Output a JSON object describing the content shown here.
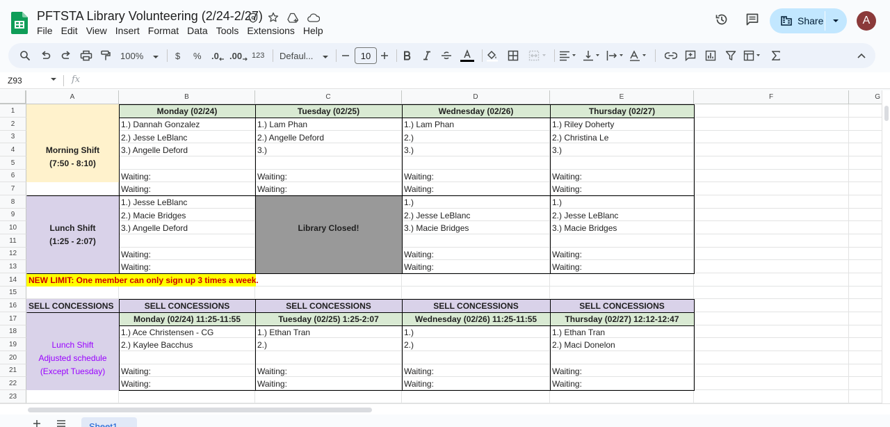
{
  "doc": {
    "title": "PFTSTA Library Volunteering (2/24-2/27)",
    "menu": [
      "File",
      "Edit",
      "View",
      "Insert",
      "Format",
      "Data",
      "Tools",
      "Extensions",
      "Help"
    ],
    "share_label": "Share",
    "avatar_letter": "A"
  },
  "toolbar": {
    "zoom": "100%",
    "currency": "$",
    "percent": "%",
    "dec_decrease": ".0",
    "dec_increase": ".00",
    "number_format": "123",
    "font": "Defaul...",
    "font_size": "10"
  },
  "formula_bar": {
    "cell_ref": "Z93",
    "fx_label": "fx"
  },
  "columns": [
    "A",
    "B",
    "C",
    "D",
    "E",
    "F",
    "G"
  ],
  "rows": [
    "1",
    "2",
    "3",
    "4",
    "5",
    "6",
    "7",
    "8",
    "9",
    "10",
    "11",
    "12",
    "13",
    "14",
    "15",
    "16",
    "17",
    "18",
    "19",
    "20",
    "21",
    "22",
    "23"
  ],
  "colors": {
    "morning_fill": "#fff2cc",
    "lunch_fill": "#d9d2e9",
    "header_fill": "#d9ead3",
    "closed_fill": "#999999",
    "notice_fill": "#ffff00",
    "notice_text": "#cc0000",
    "concession_note": "#9900ff"
  },
  "sheet": {
    "morning": {
      "label": "Morning Shift",
      "time": "(7:50 - 8:10)"
    },
    "lunch": {
      "label": "Lunch Shift",
      "time": "(1:25 - 2:07)"
    },
    "days": [
      "Monday (02/24)",
      "Tuesday (02/25)",
      "Wednesday (02/26)",
      "Thursday (02/27)"
    ],
    "morning_slots": [
      [
        "1.) Dannah Gonzalez",
        "2.) Jesse LeBlanc",
        "3.) Angelle Deford"
      ],
      [
        "1.) Lam Phan",
        "2.) Angelle Deford",
        "3.)"
      ],
      [
        "1.) Lam Phan",
        "2.)",
        "3.)"
      ],
      [
        "1.) Riley Doherty",
        "2.) Christina Le",
        "3.)"
      ]
    ],
    "lunch_slots": [
      [
        "1.) Jesse LeBlanc",
        "2.) Macie Bridges",
        "3.) Angelle Deford"
      ],
      [],
      [
        "1.)",
        "2.) Jesse LeBlanc",
        "3.) Macie Bridges"
      ],
      [
        "1.)",
        "2.) Jesse LeBlanc",
        "3.) Macie Bridges"
      ]
    ],
    "waiting": "Waiting:",
    "closed": "Library Closed!",
    "notice": "NEW LIMIT: One member can only sign up 3 times a week.",
    "sell_title": "SELL CONCESSIONS",
    "concession_note": [
      "Lunch Shift",
      "Adjusted schedule",
      "(Except Tuesday)"
    ],
    "concession_days": [
      "Monday (02/24) 11:25-11:55",
      "Tuesday (02/25) 1:25-2:07",
      "Wednesday (02/26) 11:25-11:55",
      "Thursday (02/27) 12:12-12:47"
    ],
    "concession_slots": [
      [
        "1.)  Ace Christensen - CG",
        "2.) Kaylee Bacchus"
      ],
      [
        "1.) Ethan Tran",
        "2.)"
      ],
      [
        "1.)",
        "2.)"
      ],
      [
        "1.) Ethan Tran",
        "2.) Maci Donelon"
      ]
    ]
  },
  "sheet_tab": "Sheet1"
}
